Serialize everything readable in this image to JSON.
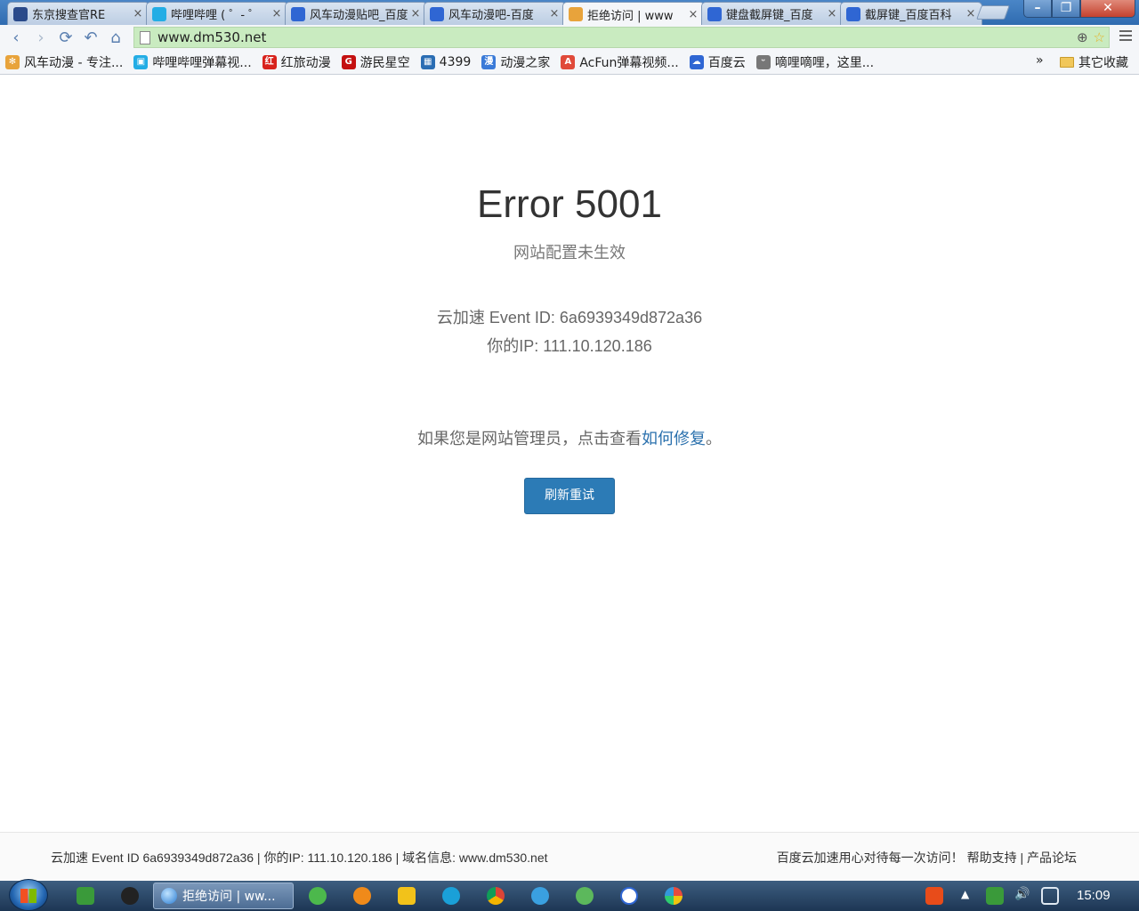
{
  "browser": {
    "tabs": [
      {
        "label": "东京搜查官RE",
        "icon_color": "#2a4a8a",
        "active": false
      },
      {
        "label": "哔哩哔哩 ( ゜- ゜",
        "icon_color": "#23ade5",
        "active": false
      },
      {
        "label": "风车动漫贴吧_百度",
        "icon_color": "#2f66d3",
        "active": false
      },
      {
        "label": "风车动漫吧-百度",
        "icon_color": "#2f66d3",
        "active": false
      },
      {
        "label": "拒绝访问 | www",
        "icon_color": "#e8a33b",
        "active": true
      },
      {
        "label": "键盘截屏键_百度",
        "icon_color": "#2f66d3",
        "active": false
      },
      {
        "label": "截屏键_百度百科",
        "icon_color": "#2f66d3",
        "active": false
      }
    ],
    "tab_close": "×",
    "nav": {
      "back": "‹",
      "forward": "›",
      "reload": "⟳",
      "undo": "↶",
      "home": "⌂"
    },
    "url": "www.dm530.net",
    "bookmarks": [
      {
        "label": "风车动漫 - 专注...",
        "icon_color": "#e8a33b",
        "icon_text": "✻"
      },
      {
        "label": "哔哩哔哩弹幕视...",
        "icon_color": "#23ade5",
        "icon_text": "▣"
      },
      {
        "label": "红旅动漫",
        "icon_color": "#d8221c",
        "icon_text": "红"
      },
      {
        "label": "游民星空",
        "icon_color": "#c41010",
        "icon_text": "G"
      },
      {
        "label": "4399",
        "icon_color": "#2a6db3",
        "icon_text": "▦"
      },
      {
        "label": "动漫之家",
        "icon_color": "#3a7ad8",
        "icon_text": "漫"
      },
      {
        "label": "AcFun弹幕视频...",
        "icon_color": "#e04a3a",
        "icon_text": "A"
      },
      {
        "label": "百度云",
        "icon_color": "#2f66d3",
        "icon_text": "☁"
      },
      {
        "label": "嘀哩嘀哩，这里...",
        "icon_color": "#777777",
        "icon_text": "ᵕ"
      }
    ],
    "bookmarks_more": "»",
    "other_bookmarks": "其它收藏"
  },
  "page": {
    "title": "Error 5001",
    "subtitle": "网站配置未生效",
    "event_id_line": "云加速 Event ID: 6a6939349d872a36",
    "ip_line": "你的IP: 111.10.120.186",
    "admin_prefix": "如果您是网站管理员，点击查看",
    "admin_link": "如何修复",
    "admin_suffix": "。",
    "refresh_button": "刷新重试"
  },
  "footer": {
    "left": "云加速 Event ID 6a6939349d872a36 | 你的IP: 111.10.120.186 | 域名信息: www.dm530.net",
    "right_prefix": "百度云加速用心对待每一次访问！",
    "help_link": "帮助支持",
    "separator": " | ",
    "forum_link": "产品论坛"
  },
  "taskbar": {
    "active_task": "拒绝访问 | ww...",
    "clock": "15:09",
    "tray_arrow": "▲"
  },
  "colors": {
    "accent_button": "#2c7bb6",
    "link": "#2a70ad",
    "omnibox_bg": "#c9ebc0"
  }
}
